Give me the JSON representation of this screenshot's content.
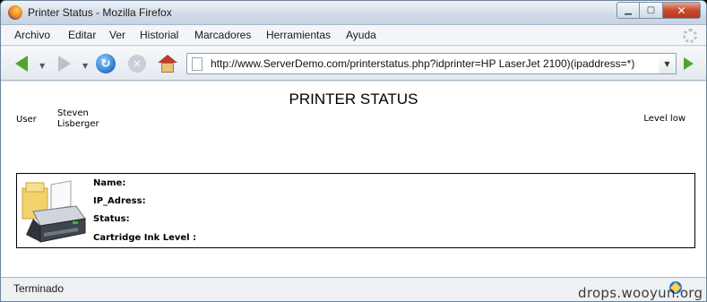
{
  "window": {
    "title": "Printer Status - Mozilla Firefox",
    "controls": {
      "minimize": "▁",
      "maximize": "▢",
      "close": "✕"
    }
  },
  "menu": {
    "items": [
      "Archivo",
      "Editar",
      "Ver",
      "Historial",
      "Marcadores",
      "Herramientas",
      "Ayuda"
    ]
  },
  "nav": {
    "url": "http://www.ServerDemo.com/printerstatus.php?idprinter=HP LaserJet 2100)(ipaddress=*)",
    "back_icon": "back-arrow-icon",
    "forward_icon": "forward-arrow-icon",
    "reload_icon": "reload-icon",
    "stop_icon": "stop-icon",
    "home_icon": "home-icon",
    "go_icon": "go-arrow-icon",
    "reload_glyph": "↻",
    "stop_glyph": "✕",
    "dropdown_glyph": "▼"
  },
  "page": {
    "title": "PRINTER STATUS",
    "user_label": "User",
    "user_name": "Steven Lisberger",
    "level": "Level low",
    "fields": {
      "name": "Name:",
      "ip": "IP_Adress:",
      "status": "Status:",
      "cartridge": "Cartridge Ink Level :"
    },
    "printer_icon": "printer-icon"
  },
  "status": {
    "text": "Terminado",
    "icon": "connection-icon"
  },
  "watermark": "drops.wooyun.org",
  "colors": {
    "accent_green": "#4ea52a",
    "close_red": "#c94a2c"
  }
}
